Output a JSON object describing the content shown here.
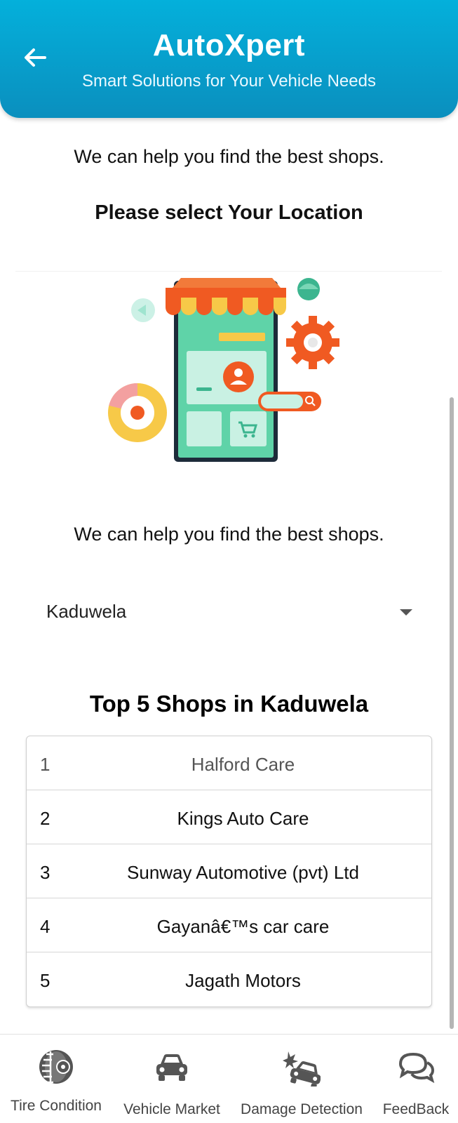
{
  "header": {
    "title": "AutoXpert",
    "subtitle": "Smart Solutions for Your Vehicle Needs",
    "back_icon": "arrow-left-icon"
  },
  "intro": {
    "help_text": "We can help you find the best shops.",
    "select_heading": "Please select Your Location",
    "help_text_2": "We can help you find the best shops."
  },
  "location": {
    "selected": "Kaduwela"
  },
  "top_shops": {
    "heading": "Top 5 Shops in Kaduwela",
    "rows": [
      {
        "rank": "1",
        "name": "Halford Care"
      },
      {
        "rank": "2",
        "name": "Kings Auto Care"
      },
      {
        "rank": "3",
        "name": "Sunway Automotive (pvt) Ltd"
      },
      {
        "rank": "4",
        "name": "Gayanâ€™s car care"
      },
      {
        "rank": "5",
        "name": "Jagath Motors"
      }
    ]
  },
  "bottom_nav": {
    "items": [
      {
        "label": "Tire Condition",
        "icon": "tire-icon"
      },
      {
        "label": "Vehicle Market",
        "icon": "car-icon"
      },
      {
        "label": "Damage Detection",
        "icon": "car-crash-icon"
      },
      {
        "label": "FeedBack",
        "icon": "chat-bubbles-icon"
      }
    ]
  },
  "colors": {
    "header_top": "#04b0db",
    "header_bottom": "#0a8fbe",
    "illustration_phone": "#5fd3a8",
    "illustration_accent": "#f05a22",
    "illustration_yellow": "#f7c948"
  }
}
